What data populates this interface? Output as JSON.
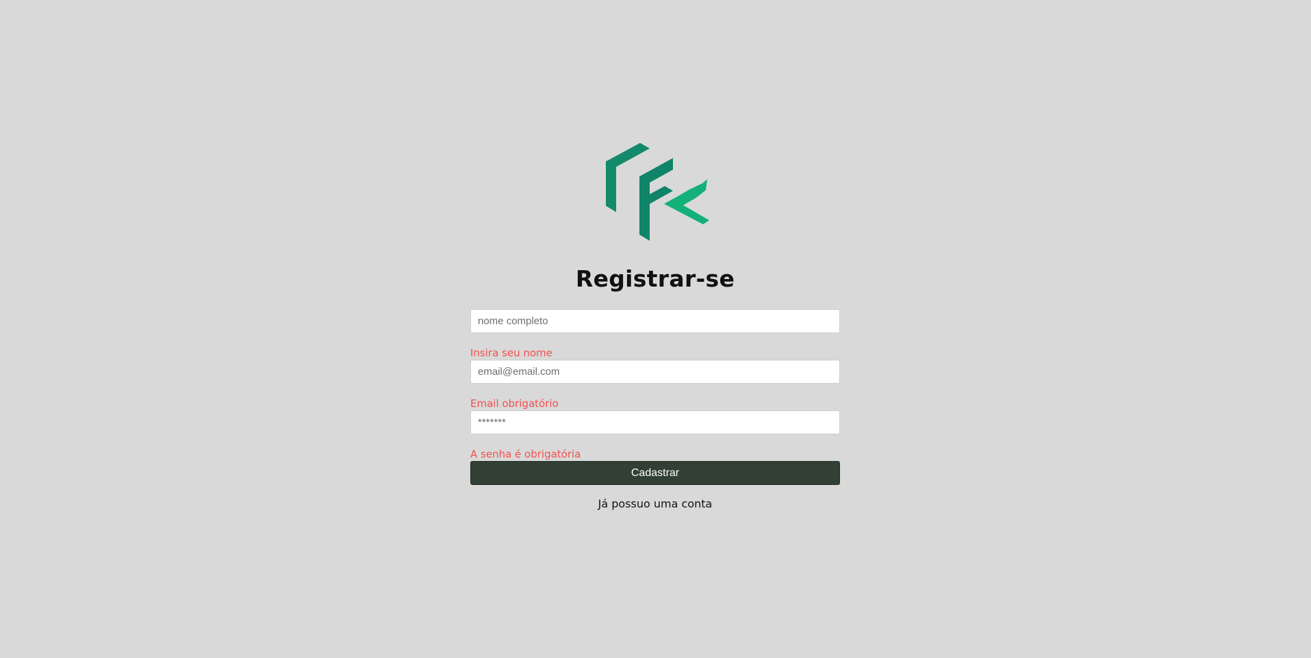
{
  "logo": {
    "icon": "fk-logo-icon",
    "colors": {
      "dark": "#128a6b",
      "light": "#14b07a"
    }
  },
  "title": "Registrar-se",
  "form": {
    "name_placeholder": "nome completo",
    "name_error": "Insira seu nome",
    "email_placeholder": "email@email.com",
    "email_error": "Email obrigatório",
    "password_placeholder": "*******",
    "password_error": "A senha é obrigatória",
    "submit_label": "Cadastrar"
  },
  "login_link": "Já possuo uma conta",
  "colors": {
    "background": "#d9d9d9",
    "error": "#f0504f",
    "button": "#313f35"
  }
}
